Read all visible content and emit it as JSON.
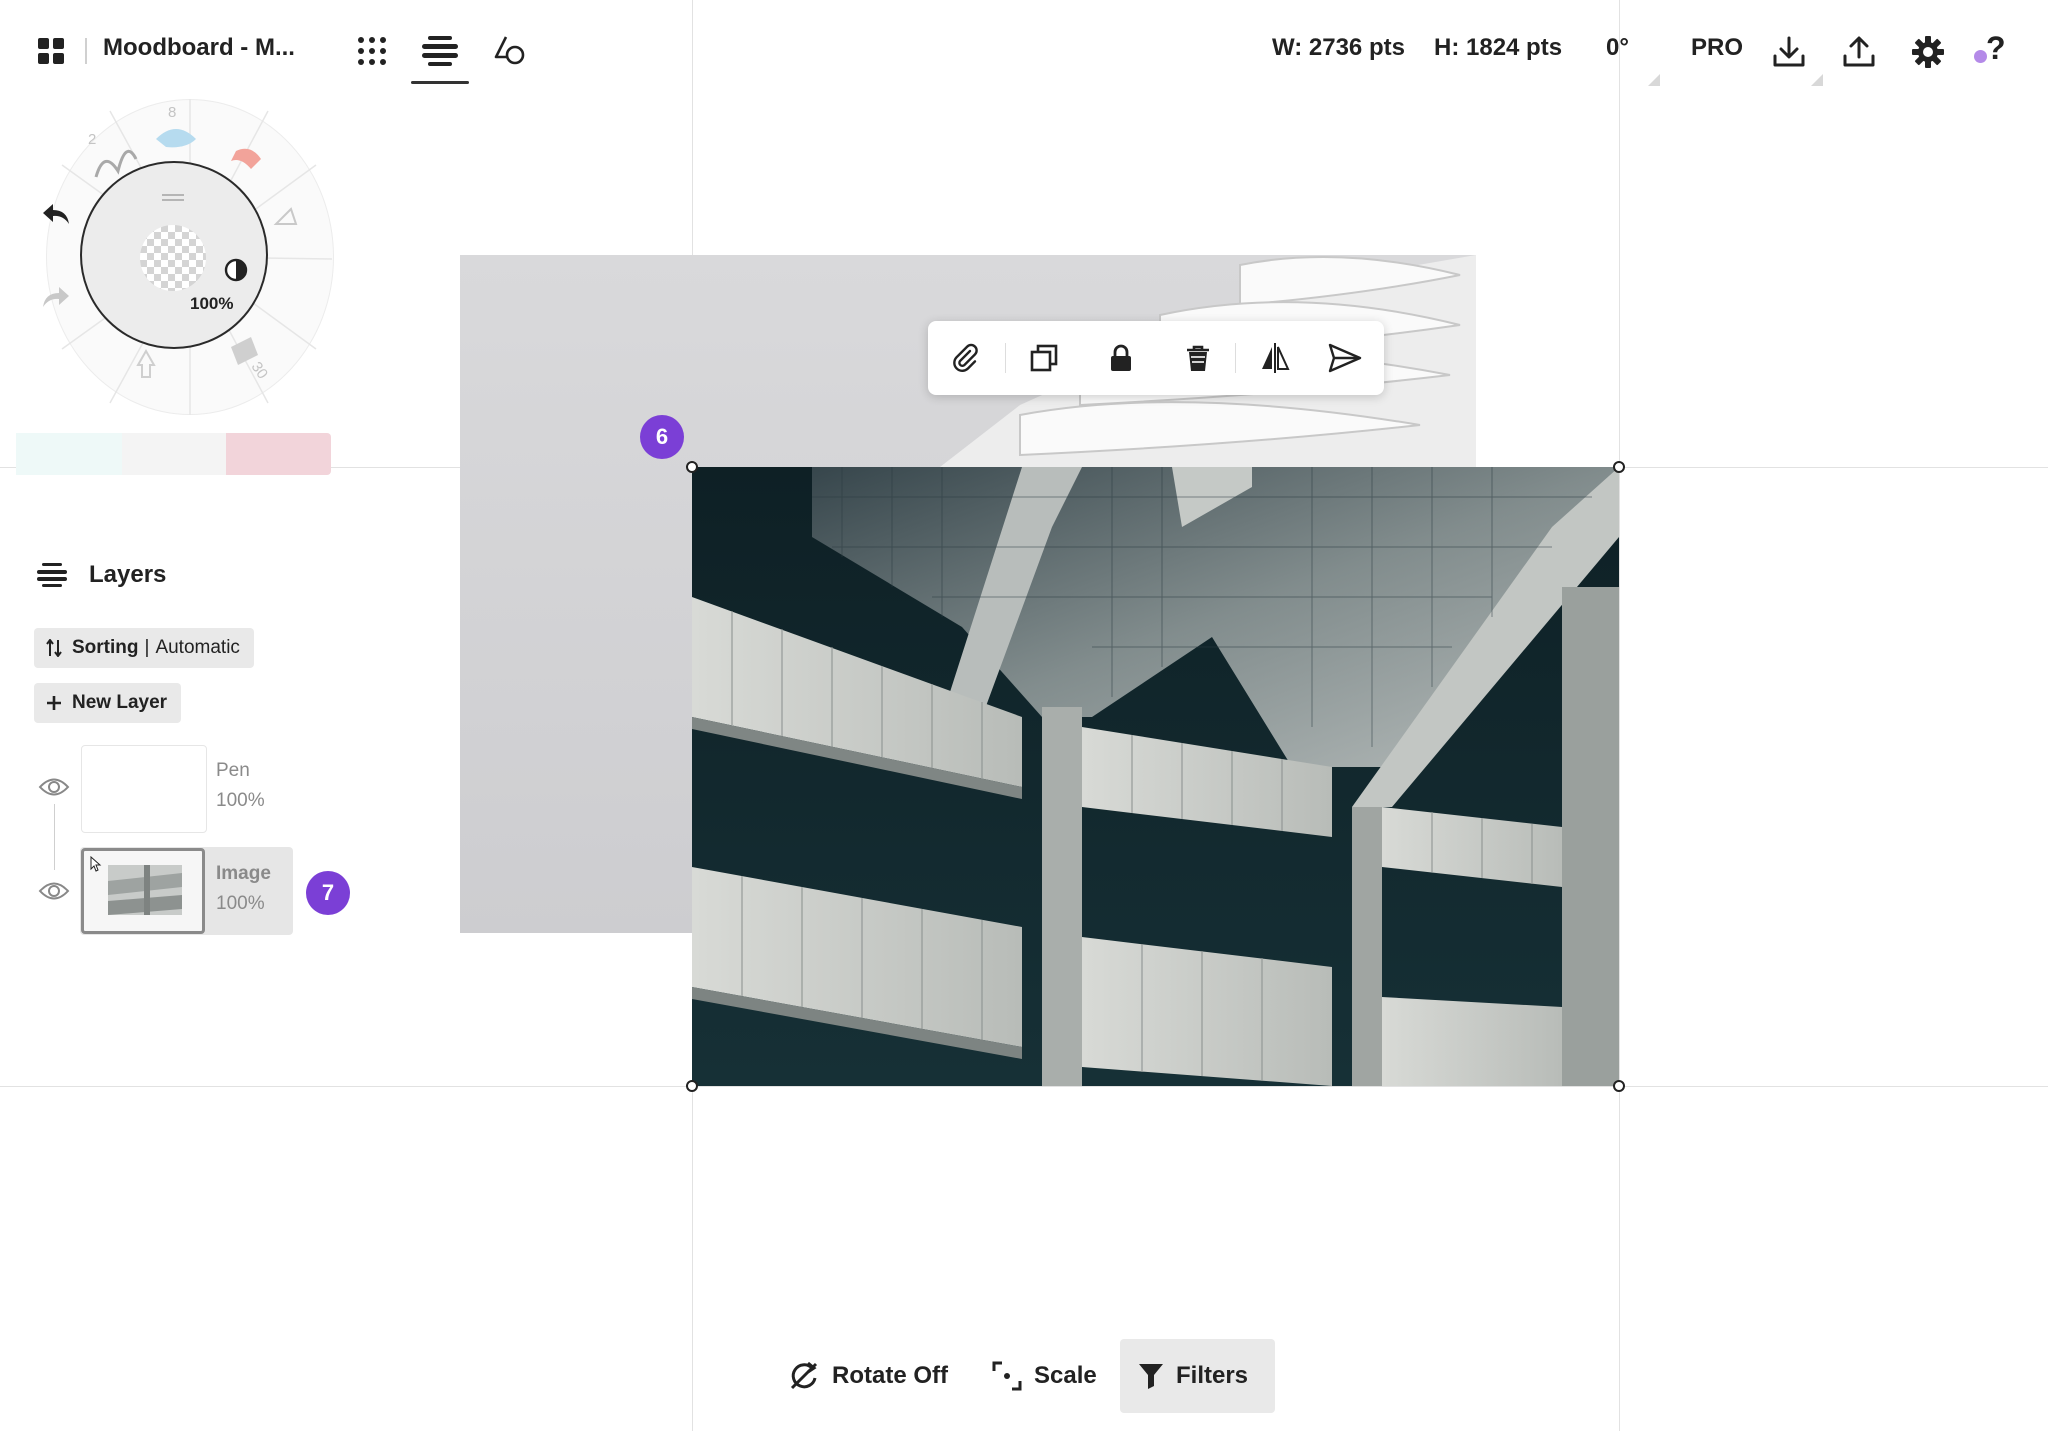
{
  "header": {
    "title": "Moodboard - M...",
    "width_label": "W: 2736 pts",
    "height_label": "H: 1824 pts",
    "rotation_label": "0°",
    "pro_label": "PRO",
    "help_label": "?"
  },
  "icons": {
    "gallery": "grid-icon",
    "brushes": "dots-grid-icon",
    "layers_tab": "layers-icon",
    "shapes": "shapes-icon",
    "download": "download-icon",
    "upload": "upload-icon",
    "settings": "gear-icon",
    "undo": "undo-icon",
    "redo": "redo-icon"
  },
  "tool_wheel": {
    "opacity": "100%",
    "size_labels": [
      "2",
      "8",
      "30"
    ],
    "swatches": [
      "#eef9f8",
      "#f4f4f4",
      "#f2d4da"
    ]
  },
  "layers": {
    "title": "Layers",
    "sorting_label": "Sorting",
    "sorting_value": "Automatic",
    "new_layer_label": "New Layer",
    "items": [
      {
        "name": "Pen",
        "opacity": "100%"
      },
      {
        "name": "Image",
        "opacity": "100%"
      }
    ]
  },
  "badges": {
    "canvas": "6",
    "layer": "7"
  },
  "float_toolbar": [
    "attach-icon",
    "duplicate-icon",
    "lock-icon",
    "delete-icon",
    "flip-horizontal-icon",
    "send-icon"
  ],
  "bottom_toolbar": {
    "rotate_label": "Rotate Off",
    "scale_label": "Scale",
    "filters_label": "Filters"
  },
  "colors": {
    "accent": "#7b3fd6",
    "wheel_ring_blue": "#2bb5e8",
    "wheel_ring_red": "#f06b5e"
  }
}
